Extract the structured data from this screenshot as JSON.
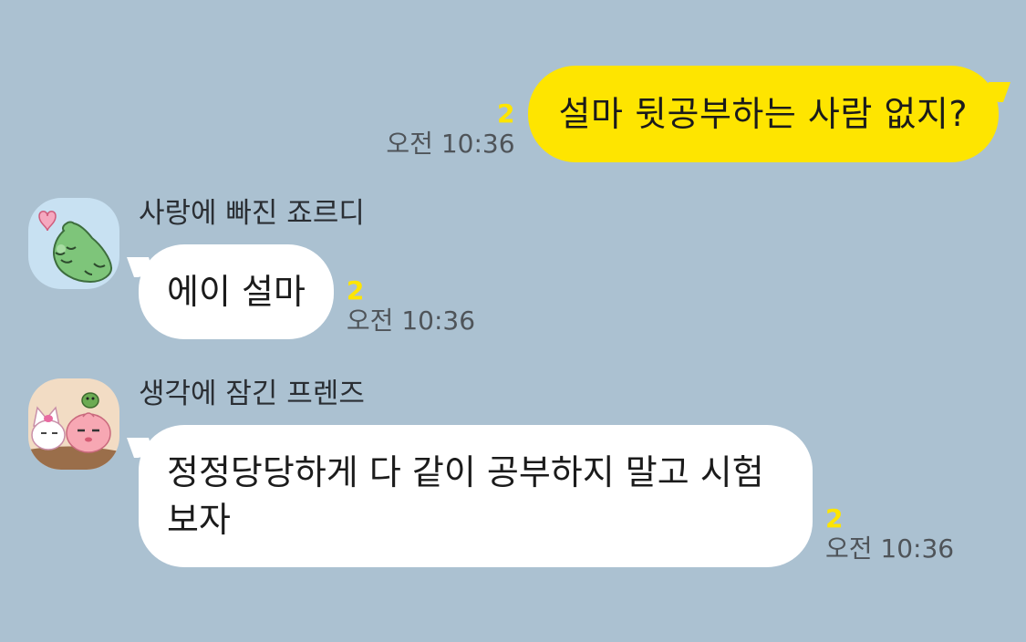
{
  "colors": {
    "background": "#abc1d1",
    "sent_bubble": "#fee500",
    "received_bubble": "#ffffff",
    "unread_count": "#fee500",
    "timestamp": "#4f5459"
  },
  "messages": [
    {
      "direction": "sent",
      "text": "설마 뒷공부하는 사람 없지?",
      "unread": "2",
      "time": "오전 10:36"
    },
    {
      "direction": "received",
      "sender": "사랑에 빠진 죠르디",
      "avatar_icon": "jordy-dinosaur-heart-avatar-icon",
      "text": "에이 설마",
      "unread": "2",
      "time": "오전 10:36"
    },
    {
      "direction": "received",
      "sender": "생각에 잠긴 프렌즈",
      "avatar_icon": "friends-apeach-neo-avatar-icon",
      "text": "정정당당하게 다 같이 공부하지 말고 시험 보자",
      "unread": "2",
      "time": "오전 10:36"
    }
  ]
}
